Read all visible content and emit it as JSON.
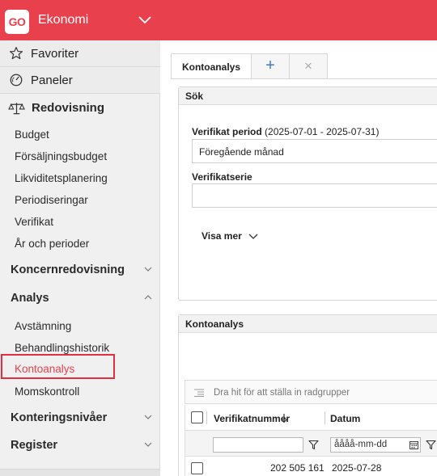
{
  "header": {
    "logo": "GO",
    "title": "Ekonomi"
  },
  "sidebar": {
    "favorites": "Favoriter",
    "panels": "Paneler",
    "section": "Redovisning",
    "items": [
      "Budget",
      "Försäljningsbudget",
      "Likviditetsplanering",
      "Periodiseringar",
      "Verifikat",
      "År och perioder"
    ],
    "koncern": "Koncernredovisning",
    "analys": "Analys",
    "analys_items": [
      "Avstämning",
      "Behandlingshistorik",
      "Kontoanalys",
      "Momskontroll"
    ],
    "kontering": "Konteringsnivåer",
    "register": "Register"
  },
  "tabs": {
    "active": "Kontoanalys",
    "add": "+",
    "close": "×"
  },
  "search_panel": {
    "title": "Sök",
    "period_label": "Verifikat period",
    "period_range": "(2025-07-01 - 2025-07-31)",
    "period_value": "Föregående månad",
    "series_label": "Verifikatserie",
    "series_value": "",
    "show_more": "Visa mer"
  },
  "result_panel": {
    "title": "Kontoanalys"
  },
  "grid": {
    "group_hint": "Dra hit för att ställa in radgrupper",
    "columns": [
      "Verifikatnummer",
      "Datum"
    ],
    "date_placeholder": "åååå-mm-dd",
    "rows": [
      {
        "verifikatnummer": "202 505 161",
        "datum": "2025-07-28"
      }
    ]
  },
  "colors": {
    "brand": "#e8414d",
    "highlight": "#e03040"
  }
}
